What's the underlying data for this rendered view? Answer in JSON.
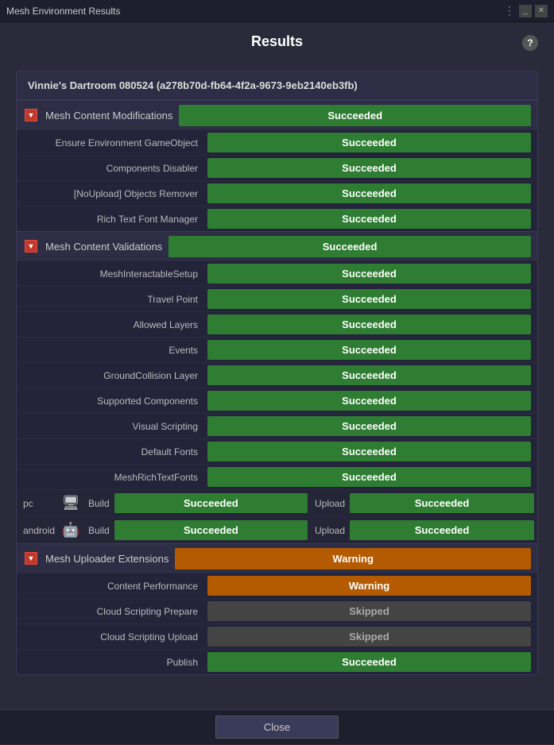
{
  "titleBar": {
    "title": "Mesh Environment Results",
    "controls": [
      "dots",
      "minimize",
      "close"
    ]
  },
  "pageTitle": "Results",
  "helpIcon": "?",
  "roomHeader": "Vinnie's Dartroom 080524 (a278b70d-fb64-4f2a-9673-9eb2140eb3fb)",
  "sections": [
    {
      "id": "mesh-content-modifications",
      "label": "Mesh Content Modifications",
      "status": "Succeeded",
      "statusType": "succeeded",
      "rows": [
        {
          "label": "Ensure Environment GameObject",
          "status": "Succeeded",
          "statusType": "succeeded"
        },
        {
          "label": "Components Disabler",
          "status": "Succeeded",
          "statusType": "succeeded"
        },
        {
          "label": "[NoUpload] Objects Remover",
          "status": "Succeeded",
          "statusType": "succeeded"
        },
        {
          "label": "Rich Text Font Manager",
          "status": "Succeeded",
          "statusType": "succeeded"
        }
      ]
    },
    {
      "id": "mesh-content-validations",
      "label": "Mesh Content Validations",
      "status": "Succeeded",
      "statusType": "succeeded",
      "rows": [
        {
          "label": "MeshInteractableSetup",
          "status": "Succeeded",
          "statusType": "succeeded"
        },
        {
          "label": "Travel Point",
          "status": "Succeeded",
          "statusType": "succeeded"
        },
        {
          "label": "Allowed Layers",
          "status": "Succeeded",
          "statusType": "succeeded"
        },
        {
          "label": "Events",
          "status": "Succeeded",
          "statusType": "succeeded"
        },
        {
          "label": "GroundCollision Layer",
          "status": "Succeeded",
          "statusType": "succeeded"
        },
        {
          "label": "Supported Components",
          "status": "Succeeded",
          "statusType": "succeeded"
        },
        {
          "label": "Visual Scripting",
          "status": "Succeeded",
          "statusType": "succeeded"
        },
        {
          "label": "Default Fonts",
          "status": "Succeeded",
          "statusType": "succeeded"
        },
        {
          "label": "MeshRichTextFonts",
          "status": "Succeeded",
          "statusType": "succeeded"
        }
      ]
    }
  ],
  "platforms": [
    {
      "name": "pc",
      "icon": "🖥",
      "build": {
        "label": "Build",
        "status": "Succeeded",
        "statusType": "succeeded"
      },
      "upload": {
        "label": "Upload",
        "status": "Succeeded",
        "statusType": "succeeded"
      }
    },
    {
      "name": "android",
      "icon": "🤖",
      "build": {
        "label": "Build",
        "status": "Succeeded",
        "statusType": "succeeded"
      },
      "upload": {
        "label": "Upload",
        "status": "Succeeded",
        "statusType": "succeeded"
      }
    }
  ],
  "uploaderExtensions": {
    "label": "Mesh Uploader Extensions",
    "status": "Warning",
    "statusType": "warning",
    "rows": [
      {
        "label": "Content Performance",
        "status": "Warning",
        "statusType": "warning"
      },
      {
        "label": "Cloud Scripting Prepare",
        "status": "Skipped",
        "statusType": "skipped"
      },
      {
        "label": "Cloud Scripting Upload",
        "status": "Skipped",
        "statusType": "skipped"
      },
      {
        "label": "Publish",
        "status": "Succeeded",
        "statusType": "succeeded"
      }
    ]
  },
  "closeButton": "Close"
}
